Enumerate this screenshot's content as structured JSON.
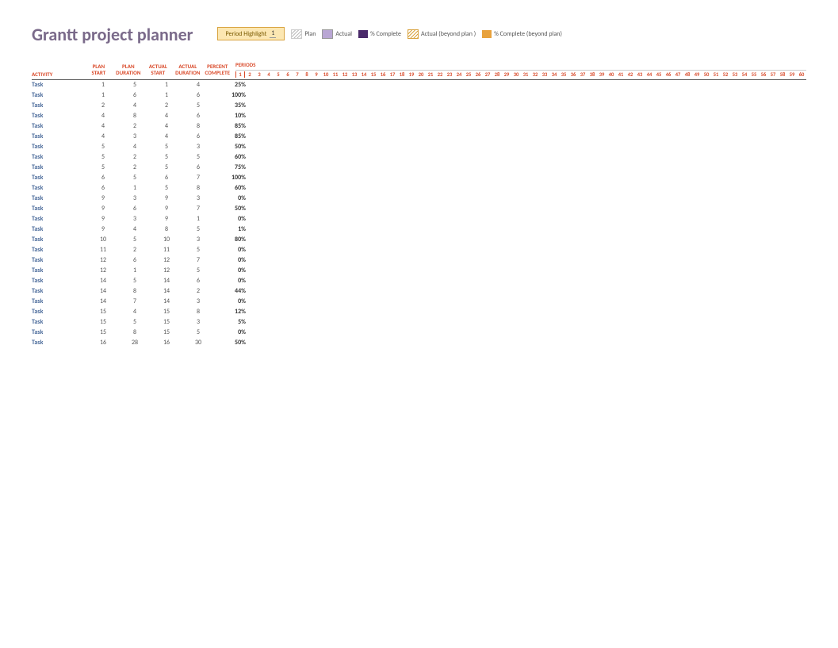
{
  "title": "Grantt project planner",
  "legend": {
    "highlight_label": "Period Highlight",
    "highlight_value": "1",
    "plan": "Plan",
    "actual": "Actual",
    "complete": "% Complete",
    "actual_beyond": "Actual (beyond plan )",
    "complete_beyond": "% Complete (beyond plan)"
  },
  "columns": {
    "activity": "ACTIVITY",
    "plan_start": "PLAN START",
    "plan_duration": "PLAN DURATION",
    "actual_start": "ACTUAL START",
    "actual_duration": "ACTUAL DURATION",
    "percent_complete": "PERCENT COMPLETE",
    "periods": "PERIODS"
  },
  "period_count": 60,
  "tasks": [
    {
      "name": "Task",
      "ps": 1,
      "pd": 5,
      "as": 1,
      "ad": 4,
      "pct": "25%"
    },
    {
      "name": "Task",
      "ps": 1,
      "pd": 6,
      "as": 1,
      "ad": 6,
      "pct": "100%"
    },
    {
      "name": "Task",
      "ps": 2,
      "pd": 4,
      "as": 2,
      "ad": 5,
      "pct": "35%"
    },
    {
      "name": "Task",
      "ps": 4,
      "pd": 8,
      "as": 4,
      "ad": 6,
      "pct": "10%"
    },
    {
      "name": "Task",
      "ps": 4,
      "pd": 2,
      "as": 4,
      "ad": 8,
      "pct": "85%"
    },
    {
      "name": "Task",
      "ps": 4,
      "pd": 3,
      "as": 4,
      "ad": 6,
      "pct": "85%"
    },
    {
      "name": "Task",
      "ps": 5,
      "pd": 4,
      "as": 5,
      "ad": 3,
      "pct": "50%"
    },
    {
      "name": "Task",
      "ps": 5,
      "pd": 2,
      "as": 5,
      "ad": 5,
      "pct": "60%"
    },
    {
      "name": "Task",
      "ps": 5,
      "pd": 2,
      "as": 5,
      "ad": 6,
      "pct": "75%"
    },
    {
      "name": "Task",
      "ps": 6,
      "pd": 5,
      "as": 6,
      "ad": 7,
      "pct": "100%"
    },
    {
      "name": "Task",
      "ps": 6,
      "pd": 1,
      "as": 5,
      "ad": 8,
      "pct": "60%"
    },
    {
      "name": "Task",
      "ps": 9,
      "pd": 3,
      "as": 9,
      "ad": 3,
      "pct": "0%"
    },
    {
      "name": "Task",
      "ps": 9,
      "pd": 6,
      "as": 9,
      "ad": 7,
      "pct": "50%"
    },
    {
      "name": "Task",
      "ps": 9,
      "pd": 3,
      "as": 9,
      "ad": 1,
      "pct": "0%"
    },
    {
      "name": "Task",
      "ps": 9,
      "pd": 4,
      "as": 8,
      "ad": 5,
      "pct": "1%"
    },
    {
      "name": "Task",
      "ps": 10,
      "pd": 5,
      "as": 10,
      "ad": 3,
      "pct": "80%"
    },
    {
      "name": "Task",
      "ps": 11,
      "pd": 2,
      "as": 11,
      "ad": 5,
      "pct": "0%"
    },
    {
      "name": "Task",
      "ps": 12,
      "pd": 6,
      "as": 12,
      "ad": 7,
      "pct": "0%"
    },
    {
      "name": "Task",
      "ps": 12,
      "pd": 1,
      "as": 12,
      "ad": 5,
      "pct": "0%"
    },
    {
      "name": "Task",
      "ps": 14,
      "pd": 5,
      "as": 14,
      "ad": 6,
      "pct": "0%"
    },
    {
      "name": "Task",
      "ps": 14,
      "pd": 8,
      "as": 14,
      "ad": 2,
      "pct": "44%"
    },
    {
      "name": "Task",
      "ps": 14,
      "pd": 7,
      "as": 14,
      "ad": 3,
      "pct": "0%"
    },
    {
      "name": "Task",
      "ps": 15,
      "pd": 4,
      "as": 15,
      "ad": 8,
      "pct": "12%"
    },
    {
      "name": "Task",
      "ps": 15,
      "pd": 5,
      "as": 15,
      "ad": 3,
      "pct": "5%"
    },
    {
      "name": "Task",
      "ps": 15,
      "pd": 8,
      "as": 15,
      "ad": 5,
      "pct": "0%"
    },
    {
      "name": "Task",
      "ps": 16,
      "pd": 28,
      "as": 16,
      "ad": 30,
      "pct": "50%"
    }
  ]
}
